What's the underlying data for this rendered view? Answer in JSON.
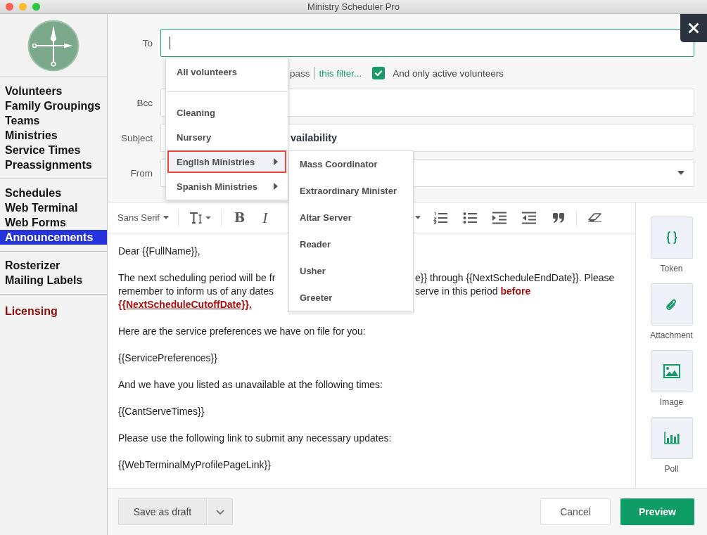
{
  "window": {
    "title": "Ministry Scheduler Pro"
  },
  "sidebar": {
    "groups": [
      {
        "items": [
          {
            "label": "Volunteers",
            "kind": "nav",
            "selected": false
          },
          {
            "label": "Family Groupings",
            "kind": "nav",
            "selected": false
          },
          {
            "label": "Teams",
            "kind": "nav",
            "selected": false
          },
          {
            "label": "Ministries",
            "kind": "nav",
            "selected": false
          },
          {
            "label": "Service Times",
            "kind": "nav",
            "selected": false
          },
          {
            "label": "Preassignments",
            "kind": "nav",
            "selected": false
          }
        ]
      },
      {
        "items": [
          {
            "label": "Schedules",
            "kind": "nav",
            "selected": false
          },
          {
            "label": "Web Terminal",
            "kind": "nav",
            "selected": false
          },
          {
            "label": "Web Forms",
            "kind": "nav",
            "selected": false
          },
          {
            "label": "Announcements",
            "kind": "nav",
            "selected": true
          }
        ]
      },
      {
        "items": [
          {
            "label": "Rosterizer",
            "kind": "nav",
            "selected": false
          },
          {
            "label": "Mailing Labels",
            "kind": "nav",
            "selected": false
          }
        ]
      },
      {
        "items": [
          {
            "label": "Licensing",
            "kind": "alert",
            "selected": false
          }
        ]
      }
    ]
  },
  "compose": {
    "to": {
      "label": "To",
      "focused": true
    },
    "filter_options": {
      "text": "pass",
      "link": "this filter...",
      "active_only": {
        "label": "And only active volunteers",
        "checked": true
      }
    },
    "bcc": {
      "label": "Bcc",
      "focused": false
    },
    "subject": {
      "label": "Subject",
      "value": "vailability",
      "focused": false
    },
    "from": {
      "label": "From",
      "focused": false
    }
  },
  "recipient_menu": {
    "sections": [
      {
        "items": [
          {
            "label": "All volunteers",
            "kind": "item",
            "selected": false
          }
        ]
      },
      {
        "items": [
          {
            "label": "Cleaning",
            "kind": "item",
            "selected": false
          },
          {
            "label": "Nursery",
            "kind": "item",
            "selected": false
          },
          {
            "label": "English Ministries",
            "kind": "group",
            "selected": true,
            "children": [
              {
                "label": "Mass Coordinator"
              },
              {
                "label": "Extraordinary Minister"
              },
              {
                "label": "Altar Server"
              },
              {
                "label": "Reader"
              },
              {
                "label": "Usher"
              },
              {
                "label": "Greeter"
              }
            ]
          },
          {
            "label": "Spanish Ministries",
            "kind": "group",
            "selected": false
          }
        ]
      }
    ]
  },
  "toolbar": {
    "font": "Sans Serif",
    "bold": "B",
    "italic": "I"
  },
  "message_body": {
    "paragraphs": [
      {
        "lines": [
          {
            "kind": "plain",
            "text": "Dear {{FullName}},"
          }
        ]
      },
      {
        "lines": [
          {
            "kind": "plain",
            "text": "The next scheduling period will be fr",
            "right_part": "e}} through {{NextScheduleEndDate}}. Please"
          },
          {
            "kind": "plain",
            "text": "remember to inform us of any dates",
            "right_part": "serve in this period **before**"
          },
          {
            "kind": "highlight",
            "text": "{{NextScheduleCutoffDate}}."
          }
        ]
      },
      {
        "lines": [
          {
            "kind": "plain",
            "text": "Here are the service preferences we have on file for you:"
          }
        ]
      },
      {
        "lines": [
          {
            "kind": "plain",
            "text": "{{ServicePreferences}}"
          }
        ]
      },
      {
        "lines": [
          {
            "kind": "plain",
            "text": "And we have you listed as unavailable at the following times:"
          }
        ]
      },
      {
        "lines": [
          {
            "kind": "plain",
            "text": "{{CantServeTimes}}"
          }
        ]
      },
      {
        "lines": [
          {
            "kind": "plain",
            "text": "Please use the following link to submit any necessary updates:"
          }
        ]
      },
      {
        "lines": [
          {
            "kind": "plain",
            "text": "{{WebTerminalMyProfilePageLink}}"
          }
        ]
      }
    ]
  },
  "insert_panel": {
    "items": [
      {
        "label": "Token",
        "kind": "token"
      },
      {
        "label": "Attachment",
        "kind": "attachment"
      },
      {
        "label": "Image",
        "kind": "image"
      },
      {
        "label": "Poll",
        "kind": "poll"
      }
    ]
  },
  "footer": {
    "save_draft": "Save as draft",
    "cancel": "Cancel",
    "preview": "Preview"
  }
}
